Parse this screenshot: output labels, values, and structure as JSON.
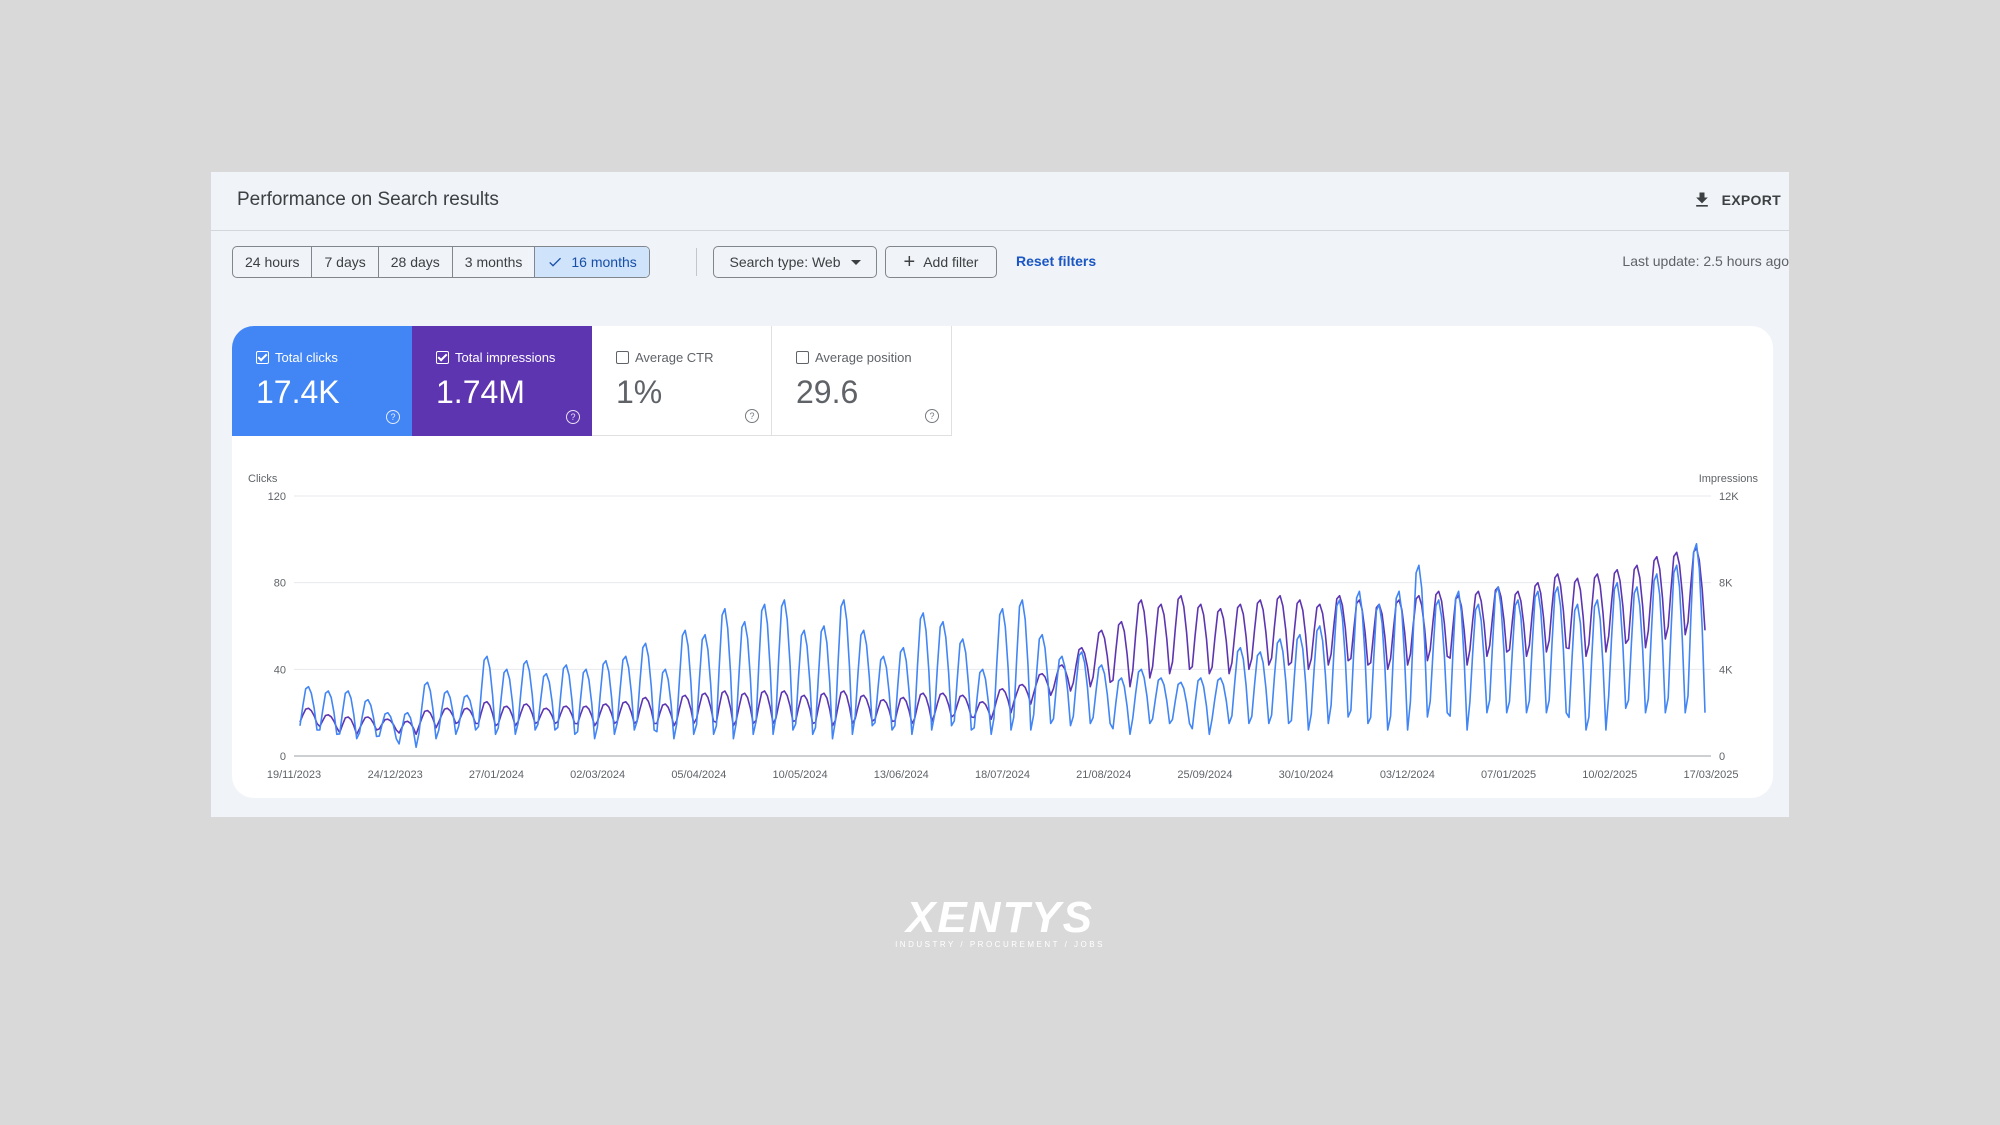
{
  "panel": {
    "title": "Performance on Search results",
    "export_label": "EXPORT"
  },
  "toolbar": {
    "ranges": [
      "24 hours",
      "7 days",
      "28 days",
      "3 months",
      "16 months"
    ],
    "active_range": "16 months",
    "search_type": "Search type: Web",
    "add_filter": "Add filter",
    "reset_filters": "Reset filters",
    "last_update": "Last update: 2.5 hours ago"
  },
  "metrics": {
    "clicks": {
      "label": "Total clicks",
      "value": "17.4K",
      "checked": true,
      "color": "#4285f4"
    },
    "impressions": {
      "label": "Total impressions",
      "value": "1.74M",
      "checked": true,
      "color": "#5e35b1"
    },
    "ctr": {
      "label": "Average CTR",
      "value": "1%",
      "checked": false
    },
    "position": {
      "label": "Average position",
      "value": "29.6",
      "checked": false
    }
  },
  "chart_data": {
    "type": "line",
    "ylabel": "Clicks",
    "y2label": "Impressions",
    "ylim": [
      0,
      120
    ],
    "y2lim": [
      0,
      12000
    ],
    "yticks": [
      "0",
      "40",
      "80",
      "120"
    ],
    "y2ticks": [
      "0",
      "4K",
      "8K",
      "12K"
    ],
    "x_tick_labels": [
      "19/11/2023",
      "24/12/2023",
      "27/01/2024",
      "02/03/2024",
      "05/04/2024",
      "10/05/2024",
      "13/06/2024",
      "18/07/2024",
      "21/08/2024",
      "25/09/2024",
      "30/10/2024",
      "03/12/2024",
      "07/01/2025",
      "10/02/2025",
      "17/03/2025"
    ],
    "grid": true,
    "series": [
      {
        "name": "Clicks",
        "axis": "left",
        "color": "#4285f4",
        "weekly_low": [
          12,
          10,
          8,
          9,
          8,
          4,
          8,
          10,
          12,
          10,
          10,
          12,
          12,
          10,
          8,
          10,
          12,
          12,
          8,
          10,
          10,
          8,
          10,
          10,
          12,
          10,
          8,
          10,
          14,
          12,
          10,
          12,
          14,
          12,
          10,
          12,
          12,
          15,
          14,
          15,
          15,
          10,
          15,
          15,
          15,
          10,
          15,
          15,
          15,
          15,
          12,
          15,
          18,
          15,
          12,
          12,
          18,
          20,
          12,
          20,
          20,
          20,
          20,
          20,
          12,
          12,
          22,
          20,
          20,
          20,
          20
        ],
        "weekly_high": [
          32,
          30,
          30,
          26,
          20,
          20,
          34,
          30,
          28,
          46,
          40,
          44,
          38,
          42,
          40,
          44,
          46,
          52,
          40,
          58,
          56,
          68,
          62,
          70,
          72,
          58,
          60,
          72,
          58,
          46,
          50,
          66,
          62,
          54,
          40,
          68,
          72,
          56,
          46,
          48,
          42,
          36,
          40,
          36,
          34,
          36,
          36,
          50,
          48,
          54,
          56,
          60,
          72,
          76,
          70,
          76,
          88,
          72,
          76,
          70,
          78,
          72,
          76,
          78,
          70,
          72,
          80,
          78,
          84,
          88,
          98
        ]
      },
      {
        "name": "Impressions",
        "axis": "right",
        "color": "#5e35b1",
        "weekly_low": [
          1500,
          1300,
          1000,
          1200,
          1200,
          1000,
          1300,
          1500,
          1500,
          1400,
          1400,
          1500,
          1500,
          1500,
          1400,
          1500,
          1500,
          1500,
          1400,
          1500,
          1600,
          1400,
          1500,
          1500,
          1600,
          1500,
          1400,
          1500,
          1600,
          1600,
          1500,
          1600,
          1800,
          1800,
          1700,
          2000,
          2400,
          2800,
          3000,
          3200,
          3400,
          3200,
          3600,
          3800,
          4000,
          3800,
          3800,
          4000,
          4200,
          4200,
          4000,
          4200,
          4400,
          4200,
          4000,
          4200,
          4400,
          4600,
          4200,
          4600,
          4800,
          4600,
          4800,
          5000,
          4600,
          4800,
          5200,
          5000,
          5400,
          5600,
          5800
        ],
        "weekly_high": [
          2200,
          1900,
          1800,
          1800,
          1700,
          1600,
          2100,
          2200,
          2200,
          2500,
          2300,
          2400,
          2200,
          2300,
          2300,
          2400,
          2500,
          2700,
          2400,
          2800,
          2900,
          3000,
          2900,
          3000,
          3000,
          2800,
          2900,
          3000,
          2800,
          2600,
          2700,
          2900,
          2900,
          2800,
          2500,
          3100,
          3300,
          3800,
          4200,
          5000,
          5800,
          6200,
          7200,
          7000,
          7400,
          7000,
          6800,
          7000,
          7200,
          7400,
          7200,
          7000,
          7400,
          7200,
          7000,
          7200,
          7400,
          7600,
          7400,
          7600,
          7800,
          7600,
          8000,
          8400,
          8200,
          8400,
          8600,
          8800,
          9200,
          9400,
          9600
        ]
      }
    ]
  },
  "brand": {
    "name": "XENTYS",
    "tagline": "INDUSTRY / PROCUREMENT / JOBS"
  }
}
